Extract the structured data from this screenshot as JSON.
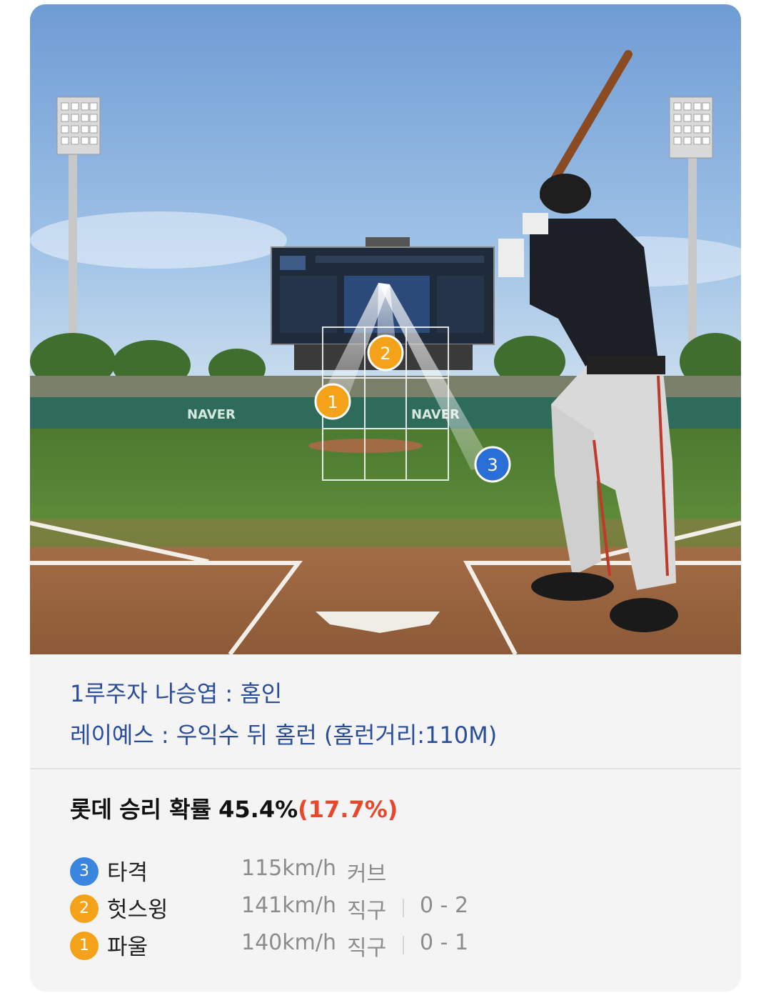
{
  "scene": {
    "ad_text": "NAVER",
    "markers": [
      {
        "num": "1",
        "color": "#f5a21b"
      },
      {
        "num": "2",
        "color": "#f5a21b"
      },
      {
        "num": "3",
        "color": "#2a6fd6"
      }
    ]
  },
  "events": {
    "line1": "1루주자 나승엽 : 홈인",
    "line2": "레이예스 : 우익수 뒤 홈런 (홈런거리:110M)"
  },
  "summary": {
    "team": "롯데",
    "label": "승리 확률",
    "pct": "45.4%",
    "delta": "(17.7%)"
  },
  "pitches": [
    {
      "num": "3",
      "result": "타격",
      "speed": "115km/h",
      "type": "커브",
      "count": ""
    },
    {
      "num": "2",
      "result": "헛스윙",
      "speed": "141km/h",
      "type": "직구",
      "count": "0 - 2"
    },
    {
      "num": "1",
      "result": "파울",
      "speed": "140km/h",
      "type": "직구",
      "count": "0 - 1"
    }
  ],
  "colors": {
    "event_text": "#2a4d9a",
    "delta_red": "#e8472c",
    "badge_blue": "#3a86de",
    "badge_orange": "#f5a21b"
  }
}
